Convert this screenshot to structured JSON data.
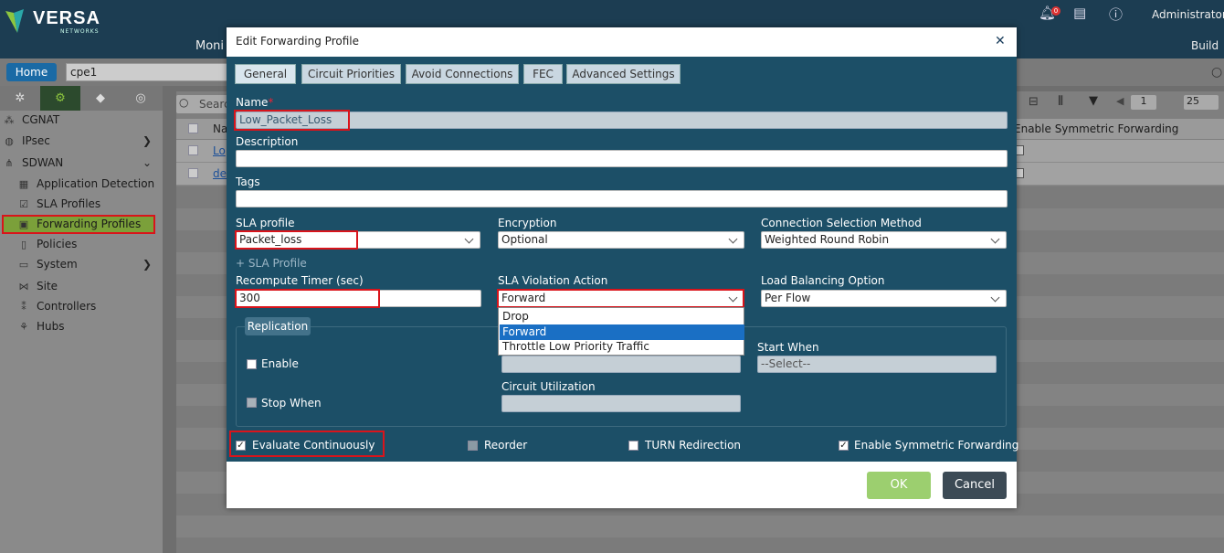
{
  "app": {
    "brand": "VERSA",
    "brand_sub": "NETWORKS",
    "user": "Administrator",
    "notifications": "0",
    "nav_monitor": "Moni",
    "nav_build": "Build",
    "home": "Home",
    "device": "cpe1",
    "search_placeholder": "Searc",
    "page_num": "1",
    "page_size": "25"
  },
  "sidebar": {
    "items": [
      {
        "label": "CGNAT",
        "icon": "network-icon"
      },
      {
        "label": "IPsec",
        "icon": "globe-icon"
      },
      {
        "label": "SDWAN",
        "icon": "tree-icon"
      },
      {
        "label": "Application Detection",
        "icon": "document-icon"
      },
      {
        "label": "SLA Profiles",
        "icon": "checklist-icon"
      },
      {
        "label": "Forwarding Profiles",
        "icon": "folder-icon"
      },
      {
        "label": "Policies",
        "icon": "file-icon"
      },
      {
        "label": "System",
        "icon": "monitor-icon"
      },
      {
        "label": "Site",
        "icon": "share-icon"
      },
      {
        "label": "Controllers",
        "icon": "cluster-icon"
      },
      {
        "label": "Hubs",
        "icon": "hub-icon"
      }
    ]
  },
  "table": {
    "col_name": "Na",
    "col_sym": "Enable Symmetric Forwarding",
    "rows": [
      "Lo",
      "de"
    ]
  },
  "modal": {
    "title": "Edit Forwarding Profile",
    "tabs": [
      "General",
      "Circuit Priorities",
      "Avoid Connections",
      "FEC",
      "Advanced Settings"
    ],
    "name_label": "Name",
    "name_required": "*",
    "name_value": "Low_Packet_Loss",
    "description_label": "Description",
    "description_value": "",
    "tags_label": "Tags",
    "tags_value": "",
    "sla_profile_label": "SLA profile",
    "sla_profile_value": "Packet_loss",
    "encryption_label": "Encryption",
    "encryption_value": "Optional",
    "csm_label": "Connection Selection Method",
    "csm_value": "Weighted Round Robin",
    "add_sla": "+ SLA Profile",
    "recompute_label": "Recompute Timer (sec)",
    "recompute_value": "300",
    "sla_violation_label": "SLA Violation Action",
    "sla_violation_value": "Forward",
    "sla_violation_options": [
      "Drop",
      "Forward",
      "Throttle Low Priority Traffic"
    ],
    "lb_label": "Load Balancing Option",
    "lb_value": "Per Flow",
    "replication_label": "Replication",
    "enable_label": "Enable",
    "stop_when_label": "Stop When",
    "start_when_label": "Start When",
    "start_when_value": "--Select--",
    "circuit_util_label": "Circuit Utilization",
    "evaluate_label": "Evaluate Continuously",
    "reorder_label": "Reorder",
    "turn_label": "TURN Redirection",
    "symmetric_label": "Enable Symmetric Forwarding",
    "ok": "OK",
    "cancel": "Cancel"
  }
}
